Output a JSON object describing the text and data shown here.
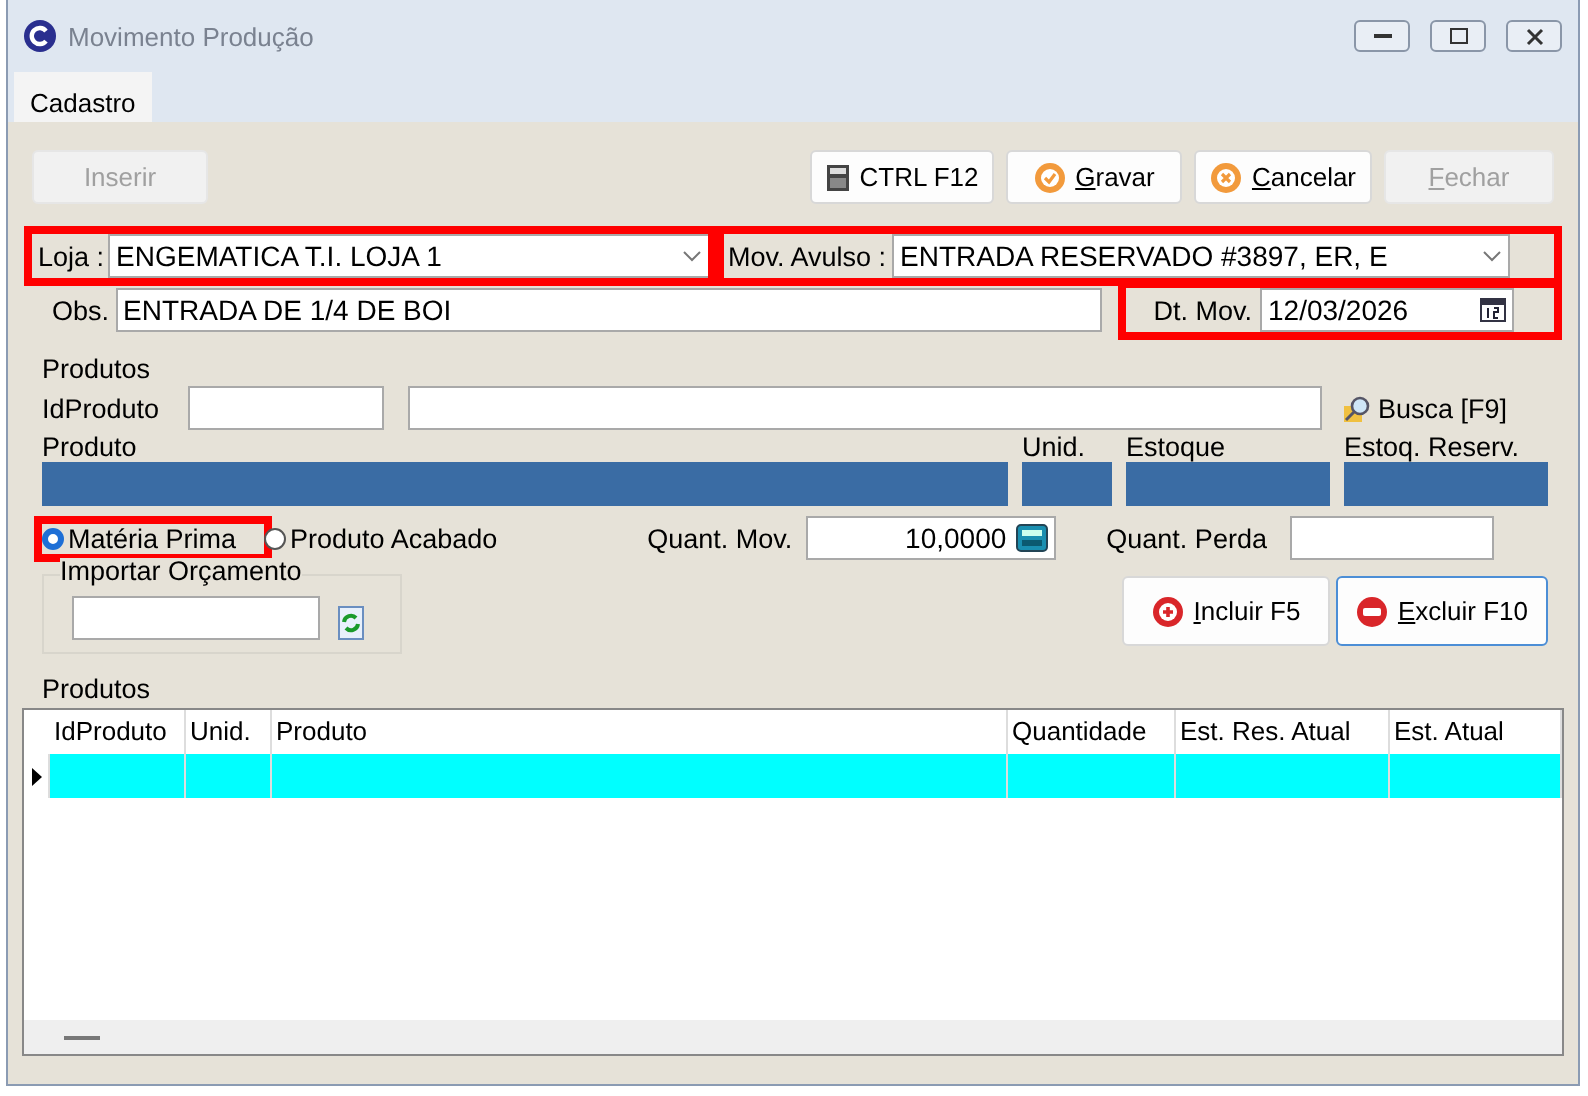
{
  "window": {
    "title": "Movimento Produção"
  },
  "tabs": [
    {
      "label": "Cadastro",
      "selected": true
    }
  ],
  "toolbar_left": [
    {
      "label": "Inserir",
      "disabled": true
    }
  ],
  "toolbar_right": [
    {
      "label": "CTRL F12",
      "disabled": false
    },
    {
      "label": "Gravar",
      "disabled": false
    },
    {
      "label": "Cancelar",
      "disabled": false
    },
    {
      "label": "Fechar",
      "disabled": true
    }
  ],
  "store": {
    "label": "Loja :",
    "value": "ENGEMATICA T.I. LOJA 1",
    "highlighted": true
  },
  "mov_avulso": {
    "label": "Mov. Avulso :",
    "value": "ENTRADA RESERVADO #3897, ER, E",
    "highlighted": true
  },
  "obs": {
    "label": "Obs.",
    "value": "ENTRADA DE 1/4 DE BOI"
  },
  "dt_mov": {
    "label": "Dt. Mov.",
    "value": "12/03/2026",
    "highlighted": true
  },
  "produto_group": {
    "title": "Produtos",
    "id_label": "IdProduto",
    "search_link": "Busca [F9]",
    "columns": [
      "Produto",
      "Unid.",
      "Estoque",
      "Estoq. Reserv."
    ]
  },
  "type_options": [
    {
      "label": "Matéria Prima",
      "selected": true,
      "highlighted": true
    },
    {
      "label": "Produto Acabado",
      "selected": false,
      "highlighted": false
    }
  ],
  "quant_mov": {
    "label": "Quant. Mov.",
    "value": "10,0000"
  },
  "quant_perda": {
    "label": "Quant. Perda"
  },
  "importar": {
    "label": "Importar Orçamento"
  },
  "item_buttons": [
    {
      "label": "Incluir F5",
      "focused": false
    },
    {
      "label": "Excluir F10",
      "focused": true
    }
  ],
  "grid": {
    "title": "Produtos",
    "columns": [
      "IdProduto",
      "Unid.",
      "Produto",
      "Quantidade",
      "Est. Res. Atual",
      "Est. Atual"
    ],
    "rows": [
      {
        "selected": true
      }
    ]
  }
}
